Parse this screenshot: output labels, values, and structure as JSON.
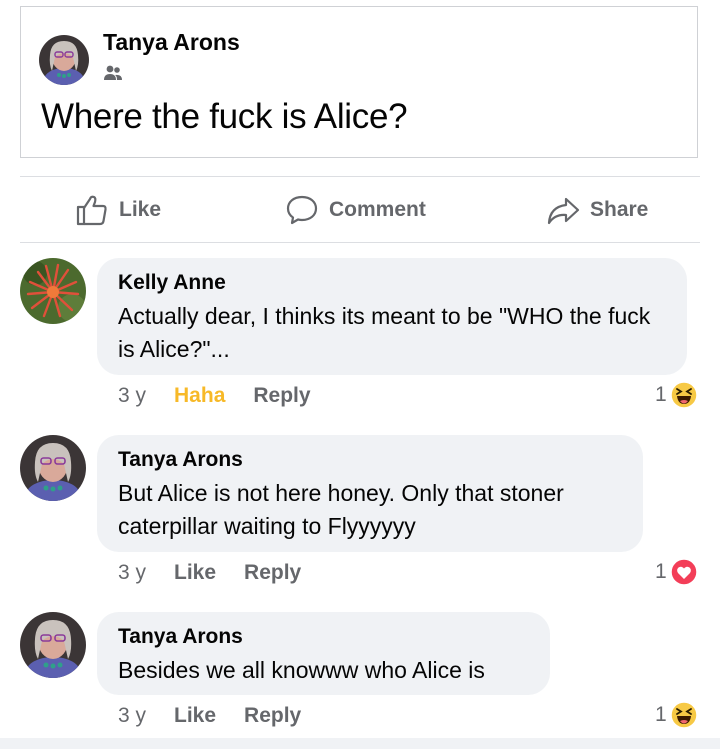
{
  "post": {
    "author": "Tanya Arons",
    "audience_icon": "friends-icon",
    "text": "Where the fuck is Alice?"
  },
  "actions": {
    "like": "Like",
    "comment": "Comment",
    "share": "Share"
  },
  "comments": [
    {
      "author": "Kelly Anne",
      "text": "Actually dear, I thinks its meant to be \"WHO the fuck is Alice?\"...",
      "time": "3 y",
      "reaction_label": "Haha",
      "reply": "Reply",
      "reaction_count": "1",
      "reaction_icon": "haha-emoji-icon"
    },
    {
      "author": "Tanya Arons",
      "text": "But Alice is not here honey. Only that stoner caterpillar waiting to Flyyyyyy",
      "time": "3 y",
      "reaction_label": "Like",
      "reply": "Reply",
      "reaction_count": "1",
      "reaction_icon": "love-heart-icon"
    },
    {
      "author": "Tanya Arons",
      "text": "Besides we all knowww who Alice is",
      "time": "3 y",
      "reaction_label": "Like",
      "reply": "Reply",
      "reaction_count": "1",
      "reaction_icon": "haha-emoji-icon"
    }
  ],
  "colors": {
    "secondary_text": "#65676b",
    "bubble_bg": "#f0f2f5",
    "haha_active": "#f7b928",
    "love_red": "#f33e58"
  }
}
